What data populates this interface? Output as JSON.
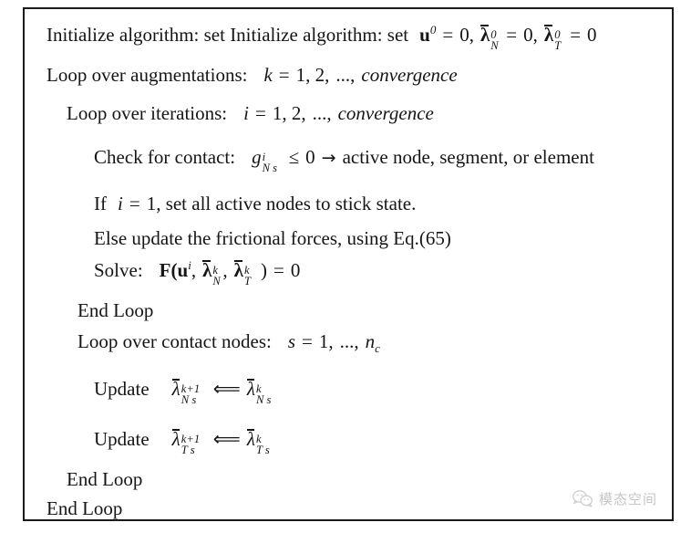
{
  "figure": {
    "kind": "algorithm-box",
    "border_color": "#1a1a1a",
    "background": "#ffffff",
    "text_color": "#151515"
  },
  "algorithm": {
    "lines": [
      {
        "id": "init",
        "indent": 0,
        "label": "Initialize algorithm: set Initialize algorithm: set",
        "math": "u^0 = 0, λ̄_N^0 = 0, λ̄_T^0 = 0"
      },
      {
        "id": "loop-augmentations",
        "indent": 0,
        "label": "Loop over augmentations:",
        "math": "k = 1, 2, ..., convergence"
      },
      {
        "id": "loop-iterations",
        "indent": 1,
        "label": "Loop over iterations:",
        "math": "i = 1, 2, ..., convergence"
      },
      {
        "id": "check-contact",
        "indent": 2,
        "label": "Check for contact:",
        "math": "g_Ns^i ≤ 0 → active node, segment, or element"
      },
      {
        "id": "if-stick",
        "indent": 2,
        "label": "If  i = 1 , set all active nodes to stick state.",
        "math": ""
      },
      {
        "id": "else-friction",
        "indent": 2,
        "label": "Else update the frictional forces, using Eq.(65)",
        "math": ""
      },
      {
        "id": "solve",
        "indent": 2,
        "label": "Solve:",
        "math": "F(u^i, λ̄_N^k, λ̄_T^k ) = 0"
      },
      {
        "id": "end-loop-inner",
        "indent": 1,
        "label": "End Loop",
        "math": ""
      },
      {
        "id": "loop-contact-nodes",
        "indent": 1,
        "label": "Loop over contact nodes:",
        "math": "s = 1, ..., n_c"
      },
      {
        "id": "update-normal",
        "indent": 2,
        "label": "Update",
        "math": "λ̄_Ns^{k+1} ⟸ λ̄_Ns^k"
      },
      {
        "id": "update-tangential",
        "indent": 2,
        "label": "Update",
        "math": "λ̄_Ts^{k+1} ⟸ λ̄_Ts^k"
      },
      {
        "id": "end-loop-middle",
        "indent": 1,
        "label": "End Loop",
        "math": ""
      },
      {
        "id": "end-loop-outer",
        "indent": 0,
        "label": "End Loop",
        "math": ""
      }
    ],
    "tokens": {
      "initialize_text": "Initialize algorithm: set Initialize algorithm: set",
      "loop_augmentations_text": "Loop over augmentations:",
      "loop_iterations_text": "Loop over iterations:",
      "check_contact_text": "Check for contact:",
      "active_node_text": "active node, segment, or element",
      "if_text": "If",
      "set_stick_text": ", set all active nodes to stick state.",
      "else_text": "Else update the frictional forces, using Eq.(65)",
      "solve_text": "Solve:",
      "end_loop_text": "End Loop",
      "loop_contact_nodes_text": "Loop over contact nodes:",
      "update_text": "Update",
      "convergence_text": "convergence",
      "u_sym": "u",
      "lambda_sym": "λ",
      "g_sym": "g",
      "F_sym": "F",
      "k_sym": "k",
      "i_sym": "i",
      "s_sym": "s",
      "n_sym": "n",
      "zero": "0",
      "one": "1",
      "two": "2",
      "ellipsis": "...",
      "eq": "=",
      "comma": ",",
      "leq": "≤",
      "rarrow": "→",
      "larrow": "⟸",
      "lparen": "(",
      "rparen": ")",
      "sup_0": "0",
      "sup_i": "i",
      "sup_k": "k",
      "sup_k1": "k+1",
      "sub_N": "N",
      "sub_T": "T",
      "sub_Ns": "N s",
      "sub_Ts": "T s",
      "sub_c": "c",
      "seq_1_2": "1, 2,",
      "seq_1": "1,"
    }
  },
  "watermark": {
    "text": "模态空间",
    "icon": "wechat-bubbles-icon",
    "color": "#c6c6c6"
  }
}
